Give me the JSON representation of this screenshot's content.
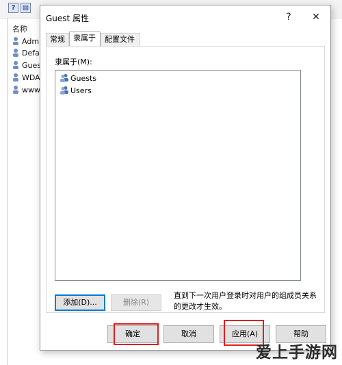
{
  "background_window": {
    "toolbar_icons": [
      "help-icon",
      "properties-icon"
    ],
    "column_header": "名称",
    "list_items": [
      "Admi",
      "Defau",
      "Gues",
      "WDA",
      "www."
    ]
  },
  "dialog": {
    "title": "Guest 属性",
    "help_glyph": "?",
    "close_glyph": "✕",
    "tabs": [
      {
        "label": "常规",
        "active": false
      },
      {
        "label": "隶属于",
        "active": true
      },
      {
        "label": "配置文件",
        "active": false
      }
    ],
    "member_of_label": "隶属于(M):",
    "members": [
      "Guests",
      "Users"
    ],
    "add_button": "添加(D)...",
    "remove_button": "删除(R)",
    "note": "直到下一次用户登录时对用户的组成员关系的更改才生效。",
    "footer": {
      "ok": "确定",
      "cancel": "取消",
      "apply": "应用(A)",
      "help": "帮助"
    }
  },
  "watermark": "爱上手游网",
  "colors": {
    "highlight": "#e11d1d",
    "focus": "#0078d7"
  }
}
